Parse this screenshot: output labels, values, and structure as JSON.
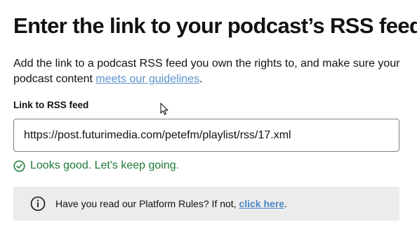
{
  "page": {
    "title": "Enter the link to your podcast’s RSS feed",
    "description_prefix": "Add the link to a podcast RSS feed you own the rights to, and make sure your podcast content ",
    "description_link": "meets our guidelines",
    "description_suffix": "."
  },
  "rss_field": {
    "label": "Link to RSS feed",
    "value": "https://post.futurimedia.com/petefm/playlist/rss/17.xml",
    "placeholder": ""
  },
  "validation": {
    "icon": "check-circle-icon",
    "message": "Looks good. Let's keep going.",
    "color": "#1f7a38"
  },
  "info_banner": {
    "icon": "info-icon",
    "text": "Have you read our Platform Rules? If not, ",
    "link": "click here",
    "suffix": "."
  },
  "colors": {
    "link": "#5a93c9",
    "success": "#1f7a38",
    "banner_background": "#ececec"
  }
}
